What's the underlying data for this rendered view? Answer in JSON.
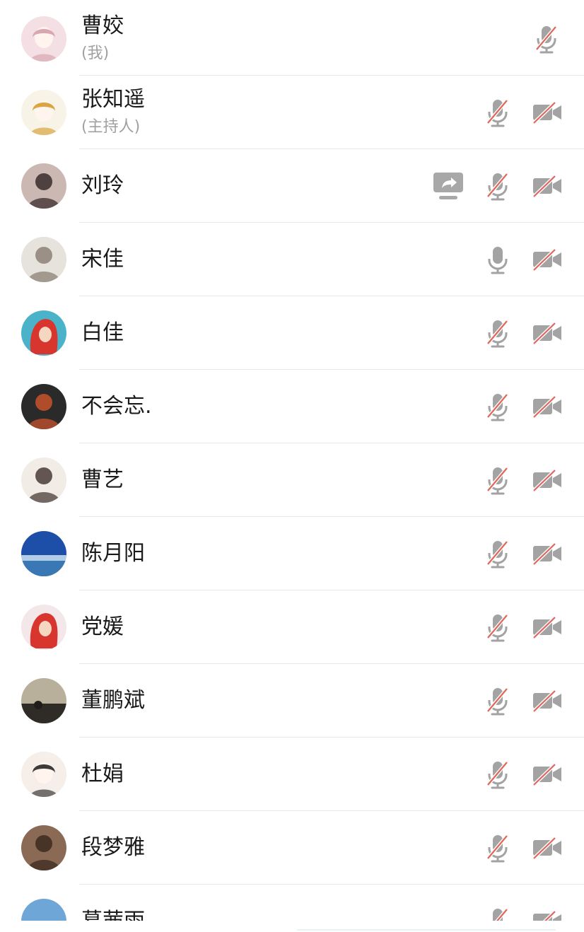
{
  "participants": [
    {
      "name": "曹姣",
      "role": "(我)",
      "avatar_icon": "avatar-girl-sketch-icon",
      "avatar_colors": [
        "#f4e0e4",
        "#d8a7b1"
      ],
      "mic": "muted",
      "camera": "none",
      "sharing": false
    },
    {
      "name": "张知遥",
      "role": "(主持人)",
      "avatar_icon": "avatar-cartoon-umbrella-icon",
      "avatar_colors": [
        "#f7f3e6",
        "#d9a441"
      ],
      "mic": "muted",
      "camera": "off",
      "sharing": false
    },
    {
      "name": "刘玲",
      "role": "",
      "avatar_icon": "avatar-photo-icon",
      "avatar_colors": [
        "#cbb8b3",
        "#3a2b2b"
      ],
      "mic": "muted",
      "camera": "off",
      "sharing": true
    },
    {
      "name": "宋佳",
      "role": "",
      "avatar_icon": "avatar-photo-icon",
      "avatar_colors": [
        "#e6e2dc",
        "#8c8176"
      ],
      "mic": "on",
      "camera": "off",
      "sharing": false
    },
    {
      "name": "白佳",
      "role": "",
      "avatar_icon": "avatar-mermaid-icon",
      "avatar_colors": [
        "#4bb3c9",
        "#d9352f"
      ],
      "mic": "muted",
      "camera": "off",
      "sharing": false
    },
    {
      "name": "不会忘.",
      "role": "",
      "avatar_icon": "avatar-photo-icon",
      "avatar_colors": [
        "#2a2a2a",
        "#c7532c"
      ],
      "mic": "muted",
      "camera": "off",
      "sharing": false
    },
    {
      "name": "曹艺",
      "role": "",
      "avatar_icon": "avatar-photo-icon",
      "avatar_colors": [
        "#f1ece6",
        "#4a3c36"
      ],
      "mic": "muted",
      "camera": "off",
      "sharing": false
    },
    {
      "name": "陈月阳",
      "role": "",
      "avatar_icon": "avatar-sky-icon",
      "avatar_colors": [
        "#1d4fa8",
        "#cfe3f2"
      ],
      "mic": "muted",
      "camera": "off",
      "sharing": false
    },
    {
      "name": "党媛",
      "role": "",
      "avatar_icon": "avatar-mermaid-icon",
      "avatar_colors": [
        "#f3e7ea",
        "#d9352f"
      ],
      "mic": "muted",
      "camera": "off",
      "sharing": false
    },
    {
      "name": "董鹏斌",
      "role": "",
      "avatar_icon": "avatar-landscape-icon",
      "avatar_colors": [
        "#b8b09a",
        "#2f2c28"
      ],
      "mic": "muted",
      "camera": "off",
      "sharing": false
    },
    {
      "name": "杜娟",
      "role": "",
      "avatar_icon": "avatar-girl-illustration-icon",
      "avatar_colors": [
        "#f6eee8",
        "#3d3a3a"
      ],
      "mic": "muted",
      "camera": "off",
      "sharing": false
    },
    {
      "name": "段梦雅",
      "role": "",
      "avatar_icon": "avatar-photo-icon",
      "avatar_colors": [
        "#8a6a55",
        "#3b2a20"
      ],
      "mic": "muted",
      "camera": "off",
      "sharing": false
    },
    {
      "name": "葛茜雨",
      "role": "",
      "avatar_icon": "avatar-sky-icon",
      "avatar_colors": [
        "#6fa6d8",
        "#dbe9f5"
      ],
      "mic": "muted",
      "camera": "off",
      "sharing": false
    }
  ],
  "colors": {
    "icon_gray": "#a3a3a3",
    "slash_red": "#e0665c",
    "share_bg": "#a8a8a8"
  }
}
